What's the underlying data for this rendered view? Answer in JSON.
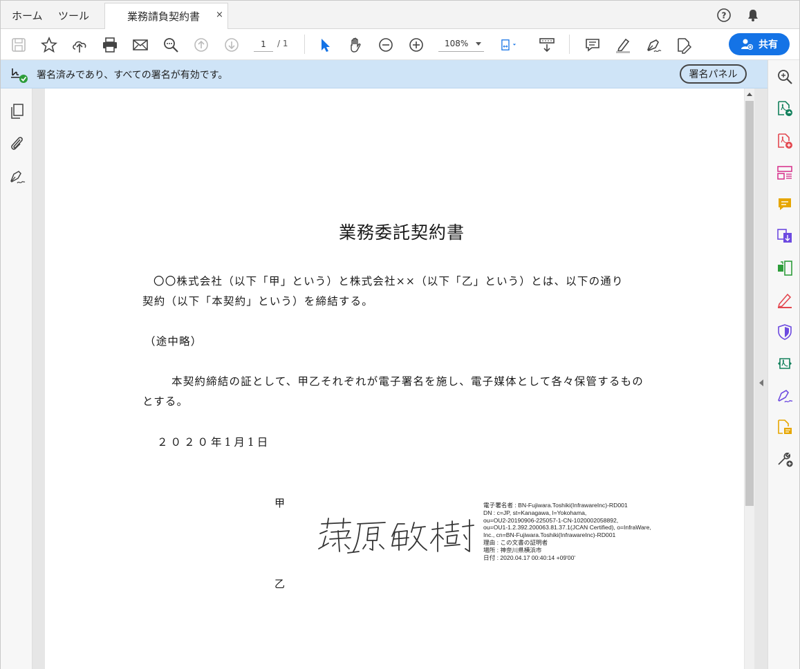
{
  "tabs": {
    "home": "ホーム",
    "tools": "ツール",
    "document": "業務請負契約書",
    "close": "×"
  },
  "toolbar": {
    "page_current": "1",
    "page_total": "/ 1",
    "zoom": "108%",
    "share_label": "共有",
    "icons": [
      "save-icon",
      "star-icon",
      "upload-icon",
      "print-icon",
      "mail-icon",
      "find-icon",
      "page-up-icon",
      "page-down-icon",
      "select-icon",
      "hand-icon",
      "zoom-out-icon",
      "zoom-in-icon",
      "fit-icon",
      "scroll-mode-icon",
      "comment-icon",
      "highlight-icon",
      "sign-icon",
      "fill-sign-icon"
    ]
  },
  "signature_bar": {
    "message": "署名済みであり、すべての署名が有効です。",
    "panel_button": "署名パネル"
  },
  "document": {
    "title": "業務委託契約書",
    "para1_line1": "〇〇株式会社（以下「甲」という）と株式会社××（以下「乙」という）とは、以下の通り",
    "para1_line2": "契約（以下「本契約」という）を締結する。",
    "omitted": "（途中略）",
    "para2_line1": "本契約締結の証として、甲乙それぞれが電子署名を施し、電子媒体として各々保管するもの",
    "para2_line2": "とする。",
    "date": "２０２０年1月1日",
    "party_a": "甲",
    "party_b": "乙",
    "signature_name": "藤原敏樹",
    "signature_details": [
      "電子署名者 : BN-Fujiwara.Toshiki(InfrawareInc)-RD001",
      "DN : c=JP, st=Kanagawa, l=Yokohama,",
      "ou=OU2-20190906-225057-1-CN-1020002058892,",
      "ou=OU1-1.2.392.200063.81.37.1(JCAN Certified), o=InfraWare,",
      "Inc., cn=BN-Fujiwara.Toshiki(InfrawareInc)-RD001",
      "理由 : この文書の証明者",
      "場所 : 神奈川県横浜市",
      "日付 : 2020.04.17 00:40:14 +09'00'"
    ]
  },
  "colors": {
    "accent": "#1473e6",
    "banner": "#cfe4f7",
    "tool_red": "#e34850",
    "tool_teal": "#12805c",
    "tool_purple": "#6d4ae0",
    "tool_yellow": "#e6a600",
    "tool_pink": "#d83790"
  }
}
